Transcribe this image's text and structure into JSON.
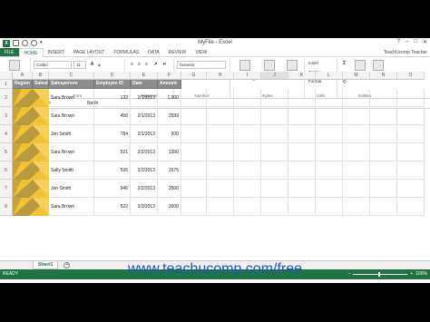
{
  "window": {
    "title": "MyFile - Excel",
    "controls": [
      "?",
      "–",
      "□",
      "✕"
    ]
  },
  "tabs": [
    "FILE",
    "HOME",
    "INSERT",
    "PAGE LAYOUT",
    "FORMULAS",
    "DATA",
    "REVIEW",
    "VIEW"
  ],
  "active_tab": "HOME",
  "user": "TeachUcomp Teacher",
  "ribbon": {
    "font_name": "Calibri",
    "font_size": "11",
    "number_format": "General",
    "group_labels": {
      "clipboard": "Clipboard",
      "font": "Font",
      "alignment": "Alignment",
      "number": "Number",
      "styles": "Styles",
      "cells": "Cells",
      "editing": "Editing"
    },
    "buttons": {
      "paste": "Paste",
      "bold": "B",
      "italic": "I",
      "underline": "U",
      "conditional_formatting": "Conditional Formatting",
      "format_as_table": "Format as Table",
      "cell_styles": "Cell Styles",
      "insert": "Insert",
      "delete": "Delete",
      "format": "Format",
      "sort_filter": "Sort & Filter",
      "find_select": "Find & Select",
      "currency": "$",
      "percent": "%",
      "comma": ","
    }
  },
  "formula_bar": {
    "name_box": "A3",
    "fx": "fx",
    "value": "North"
  },
  "columns": [
    "A",
    "B",
    "C",
    "D",
    "E",
    "F",
    "G",
    "H",
    "I",
    "J",
    "K",
    "L",
    "M",
    "N",
    "O"
  ],
  "selected_column": "J",
  "rows": [
    "1",
    "2",
    "3",
    "4",
    "5",
    "6",
    "7",
    "8"
  ],
  "headers": [
    "Region",
    "SalesID",
    "Salesperson",
    "Employee ID",
    "Date",
    "Amount"
  ],
  "data": [
    [
      "Sara Brown",
      "132",
      "2/1/2013",
      "1,900"
    ],
    [
      "Sara Brown",
      "456",
      "2/1/2013",
      "2599"
    ],
    [
      "Jon Smith",
      "784",
      "2/1/2013",
      "500"
    ],
    [
      "Sara Brown",
      "521",
      "2/2/2013",
      "1300"
    ],
    [
      "Sally Smith",
      "536",
      "2/2/2013",
      "1675"
    ],
    [
      "Jon Smith",
      "946",
      "2/2/2013",
      "2500"
    ],
    [
      "Sara Brown",
      "522",
      "2/3/2013",
      "3000"
    ]
  ],
  "sheet_tab": "Sheet1",
  "status": "READY",
  "zoom_level": "100%",
  "watermark": "www.teachucomp.com/free",
  "colors": {
    "accent": "#217346",
    "header_fill": "#8c8c8c",
    "art": "#f1c232",
    "watermark": "#1a55c8"
  }
}
